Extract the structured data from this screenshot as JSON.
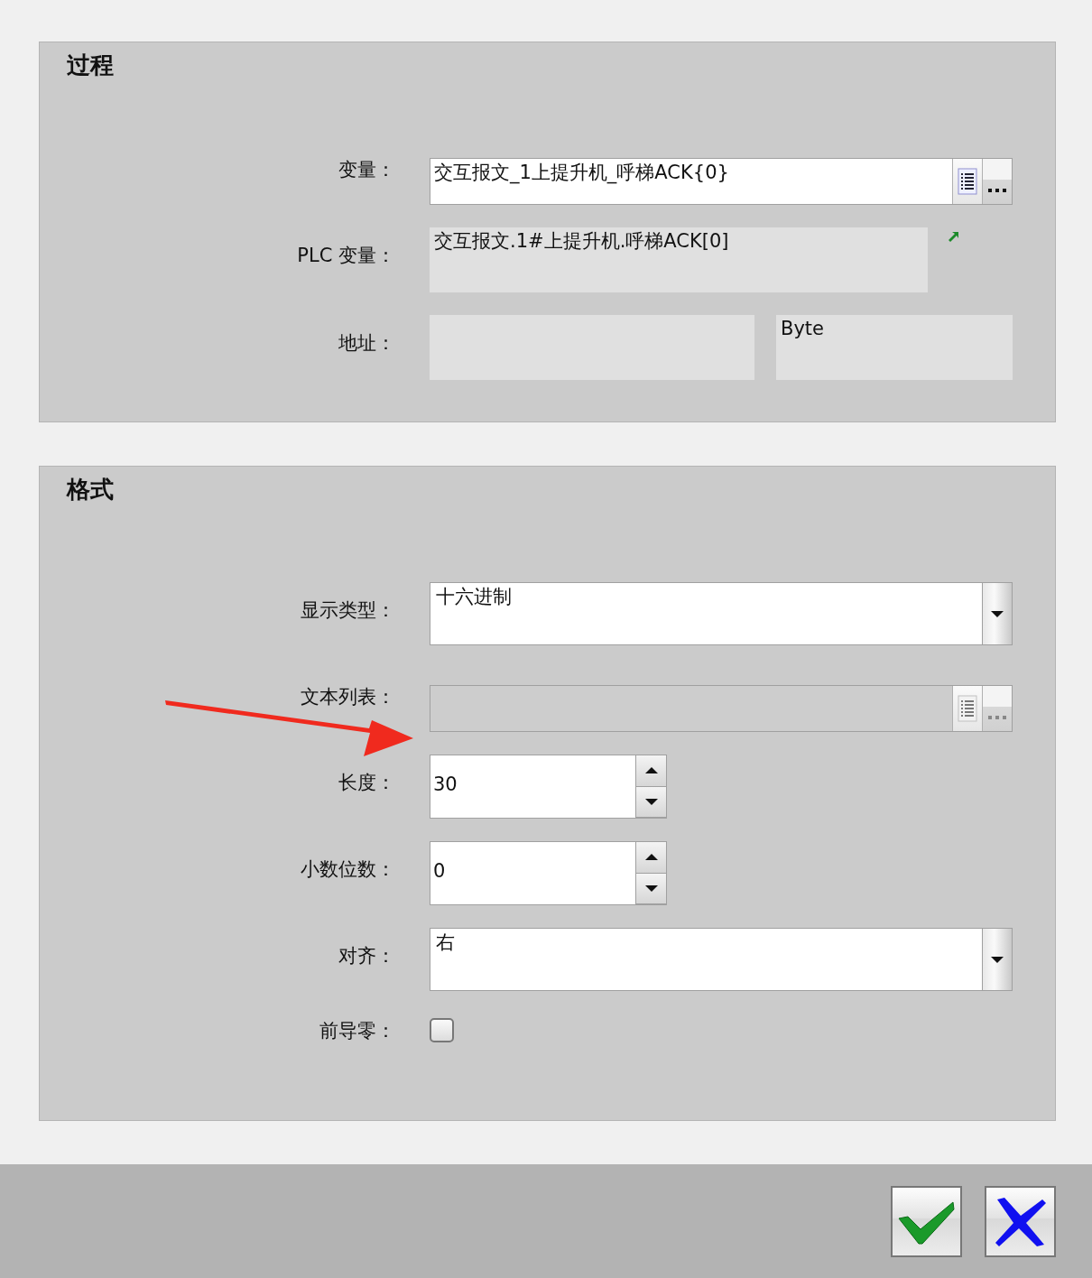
{
  "sections": [
    {
      "title": "过程",
      "rows": [
        {
          "kind": "tag-field",
          "label": "变量：",
          "value": "交互报文_1上提升机_呼梯ACK{0}",
          "disabled": false
        },
        {
          "kind": "readonly",
          "label": "PLC 变量：",
          "value": "交互报文.1#上提升机.呼梯ACK[0]"
        },
        {
          "kind": "address",
          "label": "地址：",
          "type_value": "Byte"
        }
      ]
    },
    {
      "title": "格式",
      "rows": [
        {
          "kind": "dropdown",
          "label": "显示类型：",
          "value": "十六进制"
        },
        {
          "kind": "tag-field",
          "label": "文本列表：",
          "disabled": true
        },
        {
          "kind": "spin",
          "label": "长度：",
          "value": "30"
        },
        {
          "kind": "spin",
          "label": "小数位数：",
          "value": "0"
        },
        {
          "kind": "dropdown",
          "label": "对齐：",
          "value": "右"
        },
        {
          "kind": "checkbox",
          "label": "前导零：",
          "checked": false
        }
      ]
    }
  ],
  "dialog_buttons": [
    {
      "kind": "ok"
    },
    {
      "kind": "cancel"
    }
  ],
  "annotations": [
    {
      "kind": "arrow"
    }
  ]
}
